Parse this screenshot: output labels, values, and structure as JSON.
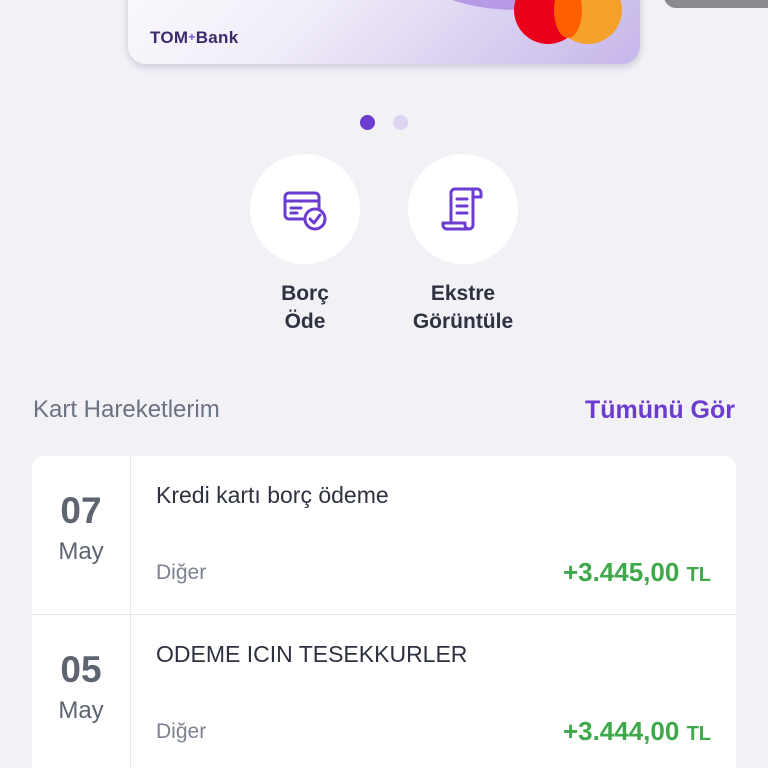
{
  "card": {
    "brand_prefix": "TOM",
    "brand_plus": "+",
    "brand_suffix": "Bank",
    "network_icon": "mastercard-logo"
  },
  "carousel": {
    "pages": 2,
    "active_index": 0
  },
  "actions": [
    {
      "label": "Borç\nÖde",
      "icon": "card-check-icon"
    },
    {
      "label": "Ekstre\nGörüntüle",
      "icon": "receipt-scroll-icon"
    }
  ],
  "section": {
    "title": "Kart Hareketlerim",
    "see_all": "Tümünü Gör"
  },
  "transactions": [
    {
      "day": "07",
      "month": "May",
      "title": "Kredi kartı borç ödeme",
      "category": "Diğer",
      "amount": "+3.445,00",
      "currency": "TL"
    },
    {
      "day": "05",
      "month": "May",
      "title": "ODEME ICIN TESEKKURLER",
      "category": "Diğer",
      "amount": "+3.444,00",
      "currency": "TL"
    }
  ],
  "colors": {
    "accent": "#6b3ccf",
    "positive": "#3fa84a",
    "background": "#f1f1f6"
  }
}
